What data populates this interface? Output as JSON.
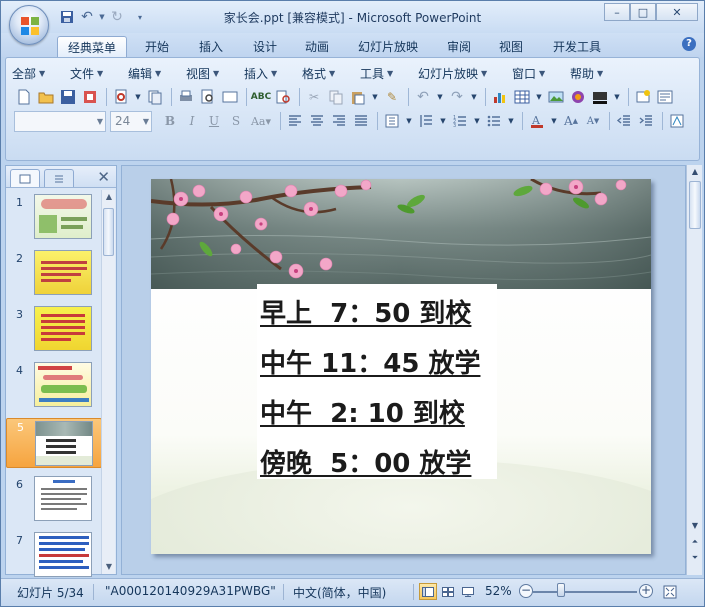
{
  "window": {
    "title": "家长会.ppt [兼容模式] - Microsoft PowerPoint",
    "minimize_label": "–",
    "maximize_label": "□",
    "close_label": "✕"
  },
  "ribbon_tabs": [
    "经典菜单",
    "开始",
    "插入",
    "设计",
    "动画",
    "幻灯片放映",
    "审阅",
    "视图",
    "开发工具"
  ],
  "active_tab": "经典菜单",
  "classic_menu": [
    "全部",
    "文件",
    "编辑",
    "视图",
    "插入",
    "格式",
    "工具",
    "幻灯片放映",
    "窗口",
    "帮助"
  ],
  "font_combo": {
    "font_name": "",
    "font_size": "24"
  },
  "slides_pane": {
    "tab_outline_icon": "slides-tab-icon",
    "tab_list_icon": "outline-tab-icon",
    "close_label": "✕",
    "thumbnails": [
      {
        "number": "1"
      },
      {
        "number": "2"
      },
      {
        "number": "3"
      },
      {
        "number": "4"
      },
      {
        "number": "5"
      },
      {
        "number": "6"
      },
      {
        "number": "7"
      }
    ],
    "selected": "5"
  },
  "slide": {
    "lines": [
      "早上  7：50 到校",
      "中午 11：45 放学",
      "中午  2: 10 到校",
      "傍晚  5：00 放学"
    ]
  },
  "status_bar": {
    "slide_position": "幻灯片 5/34",
    "theme_name": "\"A000120140929A31PWBG\"",
    "language": "中文(简体，中国)",
    "zoom_percent": "52%",
    "zoom_level_fraction": 0.52
  },
  "colors": {
    "ribbon_bg": "#d7e5f6",
    "selected_thumb": "#f6a43f",
    "slide_text": "#1b1b1b"
  }
}
